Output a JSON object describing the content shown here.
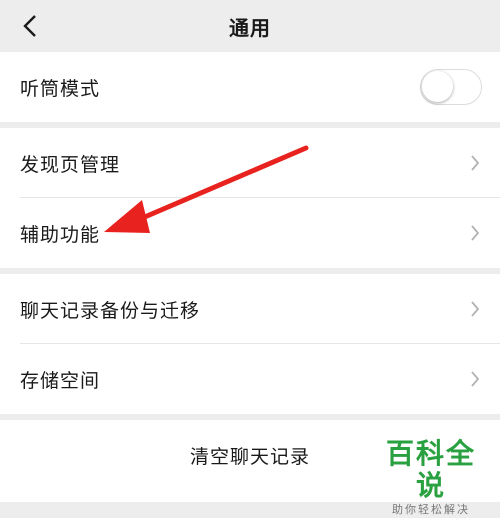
{
  "header": {
    "title": "通用",
    "back_icon": "chevron-left-icon"
  },
  "groups": [
    {
      "items": [
        {
          "label": "听筒模式",
          "control": "toggle",
          "toggle_on": false
        }
      ]
    },
    {
      "items": [
        {
          "label": "发现页管理",
          "control": "chevron-right-icon"
        },
        {
          "label": "辅助功能",
          "control": "chevron-right-icon"
        }
      ]
    },
    {
      "items": [
        {
          "label": "聊天记录备份与迁移",
          "control": "chevron-right-icon"
        },
        {
          "label": "存储空间",
          "control": "chevron-right-icon"
        }
      ]
    }
  ],
  "clear_chat": {
    "label": "清空聊天记录"
  },
  "annotation": {
    "color": "#e8231f",
    "points_to": "辅助功能"
  },
  "watermark": {
    "title": "百科全说",
    "subtitle": "助你轻松解决",
    "color": "#2aa140"
  },
  "colors": {
    "background": "#ededed",
    "card": "#ffffff",
    "text": "#1a1a1a"
  }
}
